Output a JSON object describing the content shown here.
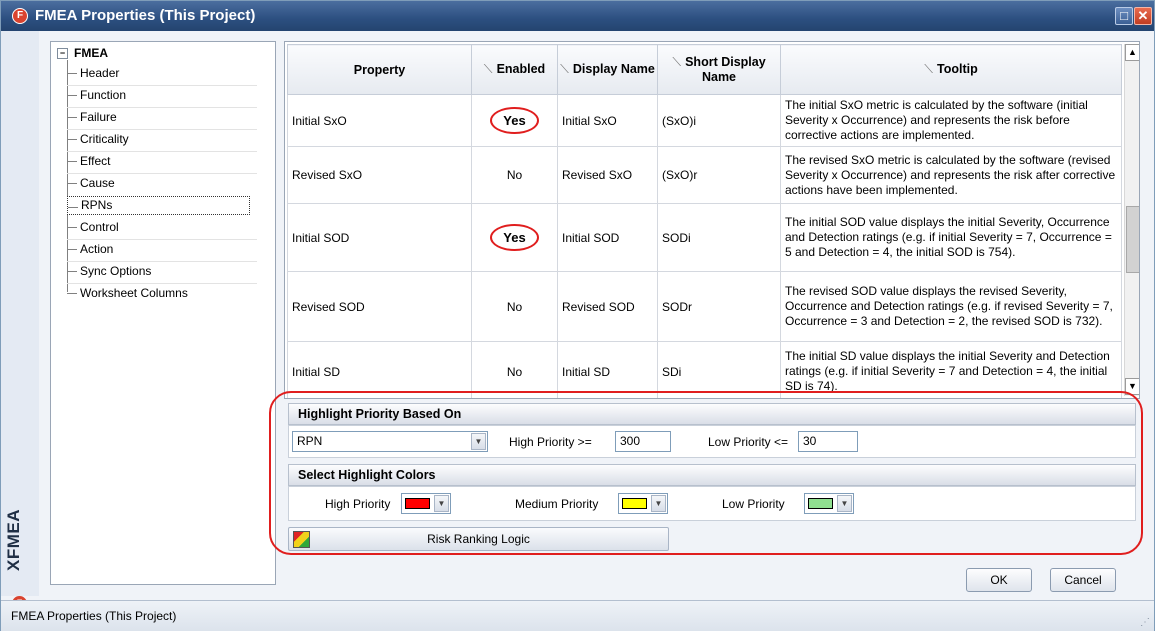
{
  "window": {
    "title": "FMEA Properties (This Project)",
    "logo_glyph": "F",
    "maximize_glyph": "□",
    "close_glyph": "✕"
  },
  "side_label": "XFMEA",
  "tree": {
    "root_label": "FMEA",
    "items": [
      {
        "label": "Header"
      },
      {
        "label": "Function"
      },
      {
        "label": "Failure"
      },
      {
        "label": "Criticality"
      },
      {
        "label": "Effect"
      },
      {
        "label": "Cause"
      },
      {
        "label": "RPNs",
        "selected": true
      },
      {
        "label": "Control"
      },
      {
        "label": "Action"
      },
      {
        "label": "Sync Options"
      },
      {
        "label": "Worksheet Columns"
      }
    ]
  },
  "grid": {
    "columns": {
      "property": "Property",
      "enabled": "Enabled",
      "display_name": "Display Name",
      "short_display_name": "Short Display Name",
      "tooltip": "Tooltip"
    },
    "rows": [
      {
        "property": "Initial SxO",
        "enabled": "Yes",
        "display_name": "Initial SxO",
        "short_display_name": "(SxO)i",
        "tooltip": "The initial SxO metric is calculated by the software (initial Severity x Occurrence) and represents the risk before corrective actions are implemented."
      },
      {
        "property": "Revised SxO",
        "enabled": "No",
        "display_name": "Revised SxO",
        "short_display_name": "(SxO)r",
        "tooltip": "The revised SxO metric is calculated by the software (revised Severity x Occurrence) and represents the risk after corrective actions have been implemented."
      },
      {
        "property": "Initial SOD",
        "enabled": "Yes",
        "display_name": "Initial SOD",
        "short_display_name": "SODi",
        "tooltip": "The initial SOD value displays the initial Severity, Occurrence and Detection ratings (e.g. if initial Severity = 7, Occurrence = 5 and Detection = 4, the initial SOD is 754)."
      },
      {
        "property": "Revised SOD",
        "enabled": "No",
        "display_name": "Revised SOD",
        "short_display_name": "SODr",
        "tooltip": "The revised SOD value displays the revised Severity, Occurrence and Detection ratings (e.g. if revised Severity = 7, Occurrence = 3 and Detection = 2, the revised SOD is 732)."
      },
      {
        "property": "Initial SD",
        "enabled": "No",
        "display_name": "Initial SD",
        "short_display_name": "SDi",
        "tooltip": "The initial SD value displays the initial Severity and Detection ratings (e.g. if initial Severity = 7 and Detection = 4, the initial SD is 74)."
      }
    ]
  },
  "highlight_priority": {
    "heading": "Highlight Priority Based On",
    "basis_value": "RPN",
    "high_label": "High Priority >=",
    "high_value": "300",
    "low_label": "Low Priority <=",
    "low_value": "30"
  },
  "highlight_colors": {
    "heading": "Select Highlight Colors",
    "high_label": "High Priority",
    "high_color": "#ff0000",
    "medium_label": "Medium Priority",
    "medium_color": "#ffff00",
    "low_label": "Low Priority",
    "low_color": "#90e090"
  },
  "risk_ranking_button": "Risk Ranking Logic",
  "buttons": {
    "ok": "OK",
    "cancel": "Cancel"
  },
  "status_bar": "FMEA Properties (This Project)"
}
